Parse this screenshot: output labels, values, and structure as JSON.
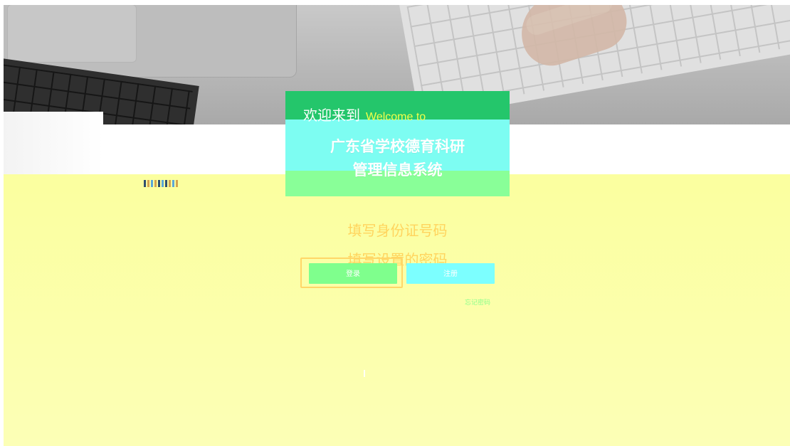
{
  "welcome": {
    "chinese": "欢迎来到",
    "english": "Welcome to"
  },
  "system": {
    "line1": "广东省学校德育科研",
    "line2": "管理信息系统"
  },
  "form": {
    "id_placeholder": "填写身份证号码",
    "password_placeholder": "填写设置的密码",
    "login_label": "登录",
    "cancel_label": "注册",
    "link_text": "忘记密码"
  },
  "colors": {
    "brand_green": "#24c66b",
    "aqua_panel": "#7dfdf2",
    "mint_panel": "#89ff98",
    "yellow_overlay": "#fcffb6",
    "accent_orange": "#ffd45e"
  },
  "icons": {
    "glitch_mark": "small-status-mark"
  }
}
